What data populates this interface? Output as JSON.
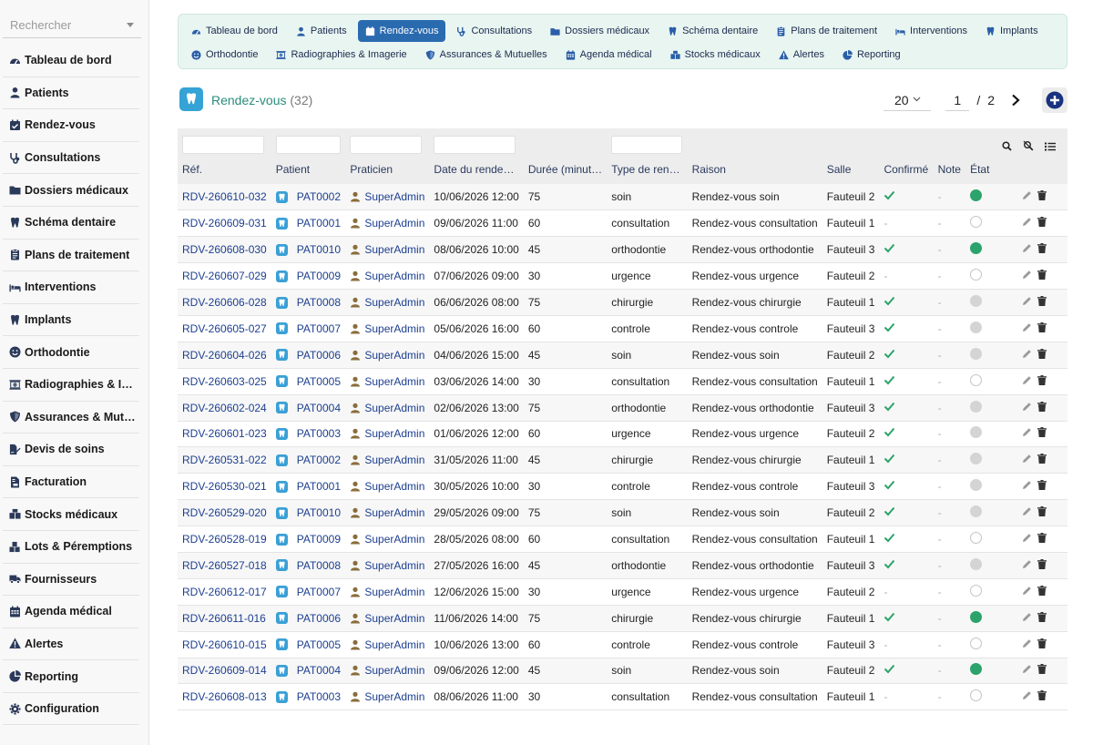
{
  "sidebar": {
    "search_placeholder": "Rechercher",
    "items": [
      {
        "label": "Tableau de bord",
        "icon": "dashboard-icon"
      },
      {
        "label": "Patients",
        "icon": "user-icon"
      },
      {
        "label": "Rendez-vous",
        "icon": "calendar-check-icon"
      },
      {
        "label": "Consultations",
        "icon": "stethoscope-icon"
      },
      {
        "label": "Dossiers médicaux",
        "icon": "folder-icon"
      },
      {
        "label": "Schéma dentaire",
        "icon": "tooth-icon"
      },
      {
        "label": "Plans de traitement",
        "icon": "clipboard-icon"
      },
      {
        "label": "Interventions",
        "icon": "bed-icon"
      },
      {
        "label": "Implants",
        "icon": "tooth-icon"
      },
      {
        "label": "Orthodontie",
        "icon": "smile-icon"
      },
      {
        "label": "Radiographies & Imagerie",
        "icon": "xray-icon"
      },
      {
        "label": "Assurances & Mutuelles",
        "icon": "shield-icon"
      },
      {
        "label": "Devis de soins",
        "icon": "file-signature-icon"
      },
      {
        "label": "Facturation",
        "icon": "invoice-icon"
      },
      {
        "label": "Stocks médicaux",
        "icon": "boxes-icon"
      },
      {
        "label": "Lots & Péremptions",
        "icon": "cubes-icon"
      },
      {
        "label": "Fournisseurs",
        "icon": "truck-icon"
      },
      {
        "label": "Agenda médical",
        "icon": "calendar-icon"
      },
      {
        "label": "Alertes",
        "icon": "warning-icon"
      },
      {
        "label": "Reporting",
        "icon": "pie-chart-icon"
      },
      {
        "label": "Configuration",
        "icon": "gear-icon"
      }
    ]
  },
  "topmenu": {
    "row1": [
      {
        "label": "Tableau de bord",
        "icon": "dashboard-icon"
      },
      {
        "label": "Patients",
        "icon": "user-icon"
      },
      {
        "label": "Rendez-vous",
        "icon": "calendar-check-icon",
        "active": true
      },
      {
        "label": "Consultations",
        "icon": "stethoscope-icon"
      },
      {
        "label": "Dossiers médicaux",
        "icon": "folder-icon"
      },
      {
        "label": "Schéma dentaire",
        "icon": "tooth-icon"
      },
      {
        "label": "Plans de traitement",
        "icon": "clipboard-icon"
      },
      {
        "label": "Interventions",
        "icon": "bed-icon"
      },
      {
        "label": "Implants",
        "icon": "tooth-icon"
      }
    ],
    "row2": [
      {
        "label": "Orthodontie",
        "icon": "smile-icon"
      },
      {
        "label": "Radiographies & Imagerie",
        "icon": "xray-icon"
      },
      {
        "label": "Assurances & Mutuelles",
        "icon": "shield-icon"
      },
      {
        "label": "Agenda médical",
        "icon": "calendar-icon"
      },
      {
        "label": "Stocks médicaux",
        "icon": "boxes-icon"
      },
      {
        "label": "Alertes",
        "icon": "warning-icon"
      },
      {
        "label": "Reporting",
        "icon": "pie-chart-icon"
      }
    ]
  },
  "header": {
    "title": "Rendez-vous",
    "count": "(32)",
    "per_page": "20",
    "page": "1",
    "page_sep": "/",
    "total_pages": "2"
  },
  "colors": {
    "accent": "#2a6bb0",
    "title": "#2a8c7a",
    "link": "#1d3f8f",
    "confirmed": "#2ca36a"
  },
  "table": {
    "columns": [
      "Réf.",
      "Patient",
      "Praticien",
      "Date du rende…",
      "Durée (minut…",
      "Type de ren…",
      "Raison",
      "Salle",
      "Confirmé",
      "Note",
      "État"
    ],
    "rows": [
      {
        "ref": "RDV-260610-032",
        "patient": "PAT0002",
        "praticien": "SuperAdmin",
        "date": "10/06/2026 12:00",
        "duree": "75",
        "type": "soin",
        "raison": "Rendez-vous soin",
        "salle": "Fauteuil 2",
        "confirme": true,
        "note": "-",
        "etat": "green"
      },
      {
        "ref": "RDV-260609-031",
        "patient": "PAT0001",
        "praticien": "SuperAdmin",
        "date": "09/06/2026 11:00",
        "duree": "60",
        "type": "consultation",
        "raison": "Rendez-vous consultation",
        "salle": "Fauteuil 1",
        "confirme": false,
        "note": "-",
        "etat": "empty"
      },
      {
        "ref": "RDV-260608-030",
        "patient": "PAT0010",
        "praticien": "SuperAdmin",
        "date": "08/06/2026 10:00",
        "duree": "45",
        "type": "orthodontie",
        "raison": "Rendez-vous orthodontie",
        "salle": "Fauteuil 3",
        "confirme": true,
        "note": "-",
        "etat": "green"
      },
      {
        "ref": "RDV-260607-029",
        "patient": "PAT0009",
        "praticien": "SuperAdmin",
        "date": "07/06/2026 09:00",
        "duree": "30",
        "type": "urgence",
        "raison": "Rendez-vous urgence",
        "salle": "Fauteuil 2",
        "confirme": false,
        "note": "-",
        "etat": "empty"
      },
      {
        "ref": "RDV-260606-028",
        "patient": "PAT0008",
        "praticien": "SuperAdmin",
        "date": "06/06/2026 08:00",
        "duree": "75",
        "type": "chirurgie",
        "raison": "Rendez-vous chirurgie",
        "salle": "Fauteuil 1",
        "confirme": true,
        "note": "-",
        "etat": "gray"
      },
      {
        "ref": "RDV-260605-027",
        "patient": "PAT0007",
        "praticien": "SuperAdmin",
        "date": "05/06/2026 16:00",
        "duree": "60",
        "type": "controle",
        "raison": "Rendez-vous controle",
        "salle": "Fauteuil 3",
        "confirme": true,
        "note": "-",
        "etat": "gray"
      },
      {
        "ref": "RDV-260604-026",
        "patient": "PAT0006",
        "praticien": "SuperAdmin",
        "date": "04/06/2026 15:00",
        "duree": "45",
        "type": "soin",
        "raison": "Rendez-vous soin",
        "salle": "Fauteuil 2",
        "confirme": true,
        "note": "-",
        "etat": "gray"
      },
      {
        "ref": "RDV-260603-025",
        "patient": "PAT0005",
        "praticien": "SuperAdmin",
        "date": "03/06/2026 14:00",
        "duree": "30",
        "type": "consultation",
        "raison": "Rendez-vous consultation",
        "salle": "Fauteuil 1",
        "confirme": true,
        "note": "-",
        "etat": "empty"
      },
      {
        "ref": "RDV-260602-024",
        "patient": "PAT0004",
        "praticien": "SuperAdmin",
        "date": "02/06/2026 13:00",
        "duree": "75",
        "type": "orthodontie",
        "raison": "Rendez-vous orthodontie",
        "salle": "Fauteuil 3",
        "confirme": true,
        "note": "-",
        "etat": "gray"
      },
      {
        "ref": "RDV-260601-023",
        "patient": "PAT0003",
        "praticien": "SuperAdmin",
        "date": "01/06/2026 12:00",
        "duree": "60",
        "type": "urgence",
        "raison": "Rendez-vous urgence",
        "salle": "Fauteuil 2",
        "confirme": true,
        "note": "-",
        "etat": "gray"
      },
      {
        "ref": "RDV-260531-022",
        "patient": "PAT0002",
        "praticien": "SuperAdmin",
        "date": "31/05/2026 11:00",
        "duree": "45",
        "type": "chirurgie",
        "raison": "Rendez-vous chirurgie",
        "salle": "Fauteuil 1",
        "confirme": true,
        "note": "-",
        "etat": "gray"
      },
      {
        "ref": "RDV-260530-021",
        "patient": "PAT0001",
        "praticien": "SuperAdmin",
        "date": "30/05/2026 10:00",
        "duree": "30",
        "type": "controle",
        "raison": "Rendez-vous controle",
        "salle": "Fauteuil 3",
        "confirme": true,
        "note": "-",
        "etat": "gray"
      },
      {
        "ref": "RDV-260529-020",
        "patient": "PAT0010",
        "praticien": "SuperAdmin",
        "date": "29/05/2026 09:00",
        "duree": "75",
        "type": "soin",
        "raison": "Rendez-vous soin",
        "salle": "Fauteuil 2",
        "confirme": true,
        "note": "-",
        "etat": "gray"
      },
      {
        "ref": "RDV-260528-019",
        "patient": "PAT0009",
        "praticien": "SuperAdmin",
        "date": "28/05/2026 08:00",
        "duree": "60",
        "type": "consultation",
        "raison": "Rendez-vous consultation",
        "salle": "Fauteuil 1",
        "confirme": true,
        "note": "-",
        "etat": "empty"
      },
      {
        "ref": "RDV-260527-018",
        "patient": "PAT0008",
        "praticien": "SuperAdmin",
        "date": "27/05/2026 16:00",
        "duree": "45",
        "type": "orthodontie",
        "raison": "Rendez-vous orthodontie",
        "salle": "Fauteuil 3",
        "confirme": true,
        "note": "-",
        "etat": "gray"
      },
      {
        "ref": "RDV-260612-017",
        "patient": "PAT0007",
        "praticien": "SuperAdmin",
        "date": "12/06/2026 15:00",
        "duree": "30",
        "type": "urgence",
        "raison": "Rendez-vous urgence",
        "salle": "Fauteuil 2",
        "confirme": false,
        "note": "-",
        "etat": "empty"
      },
      {
        "ref": "RDV-260611-016",
        "patient": "PAT0006",
        "praticien": "SuperAdmin",
        "date": "11/06/2026 14:00",
        "duree": "75",
        "type": "chirurgie",
        "raison": "Rendez-vous chirurgie",
        "salle": "Fauteuil 1",
        "confirme": true,
        "note": "-",
        "etat": "green"
      },
      {
        "ref": "RDV-260610-015",
        "patient": "PAT0005",
        "praticien": "SuperAdmin",
        "date": "10/06/2026 13:00",
        "duree": "60",
        "type": "controle",
        "raison": "Rendez-vous controle",
        "salle": "Fauteuil 3",
        "confirme": false,
        "note": "-",
        "etat": "empty"
      },
      {
        "ref": "RDV-260609-014",
        "patient": "PAT0004",
        "praticien": "SuperAdmin",
        "date": "09/06/2026 12:00",
        "duree": "45",
        "type": "soin",
        "raison": "Rendez-vous soin",
        "salle": "Fauteuil 2",
        "confirme": true,
        "note": "-",
        "etat": "green"
      },
      {
        "ref": "RDV-260608-013",
        "patient": "PAT0003",
        "praticien": "SuperAdmin",
        "date": "08/06/2026 11:00",
        "duree": "30",
        "type": "consultation",
        "raison": "Rendez-vous consultation",
        "salle": "Fauteuil 1",
        "confirme": false,
        "note": "-",
        "etat": "empty"
      }
    ]
  }
}
